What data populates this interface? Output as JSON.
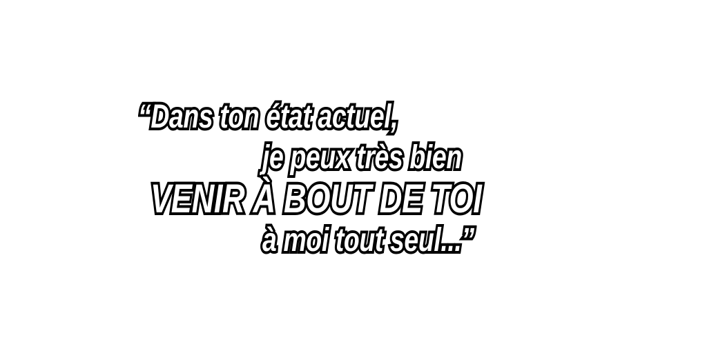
{
  "quote": {
    "line1": "“Dans ton état actuel,",
    "line2": "je peux très bien",
    "line3": "VENIR À BOUT DE TOI",
    "line4": "à moi tout seul...”"
  },
  "colors": {
    "background": "#ffffff",
    "text_fill": "#ffffff",
    "text_outline": "#000000"
  }
}
